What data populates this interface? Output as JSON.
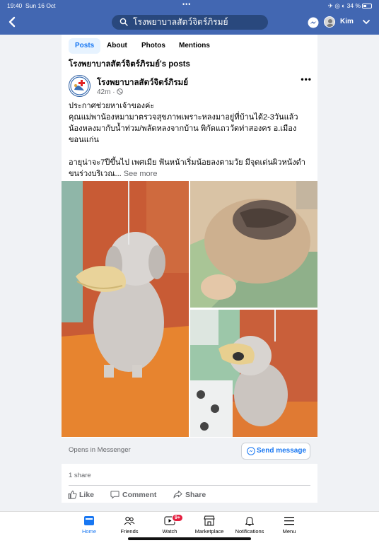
{
  "status_bar": {
    "time": "19:40",
    "date": "Sun 16 Oct",
    "battery": "34 %"
  },
  "header": {
    "search_text": "โรงพยาบาลสัตว์จิตร์ภิรมย์",
    "user_name": "Kim"
  },
  "tabs": [
    {
      "label": "Posts"
    },
    {
      "label": "About"
    },
    {
      "label": "Photos"
    },
    {
      "label": "Mentions"
    }
  ],
  "posts_title": "โรงพยาบาลสัตว์จิตร์ภิรมย์'s posts",
  "post": {
    "page_name": "โรงพยาบาลสัตว์จิตร์ภิรมย์",
    "time": "42m · ",
    "line1": "ประกาศช่วยหาเจ้าของค่ะ",
    "line2": "คุณแม่พาน้องหมามาตรวจสุขภาพเพราะหลงมาอยู่ที่บ้านได้2-3วันแล้ว น้องหลงมากับน้ำท่วม/พลัดหลงจากบ้าน พิกัดแถววัดท่าสองคร อ.เมือง ขอนแก่น",
    "line3": "อายุน่าจะ7ปีขึ้นไป เพศเมีย ฟันหน้าเริ่มน้อยลงตามวัย มีจุดเด่นผิวหนังดำ ขนร่วงบริเวณ...",
    "see_more": "See more",
    "opens_in": "Opens in Messenger",
    "send_message": "Send message",
    "shares": "1 share",
    "like": "Like",
    "comment": "Comment",
    "share": "Share"
  },
  "bottom_nav": [
    {
      "label": "Home"
    },
    {
      "label": "Friends"
    },
    {
      "label": "Watch",
      "badge": "9+"
    },
    {
      "label": "Marketplace"
    },
    {
      "label": "Notifications"
    },
    {
      "label": "Menu"
    }
  ],
  "colors": {
    "header": "#4267b2",
    "accent": "#1877f2"
  }
}
